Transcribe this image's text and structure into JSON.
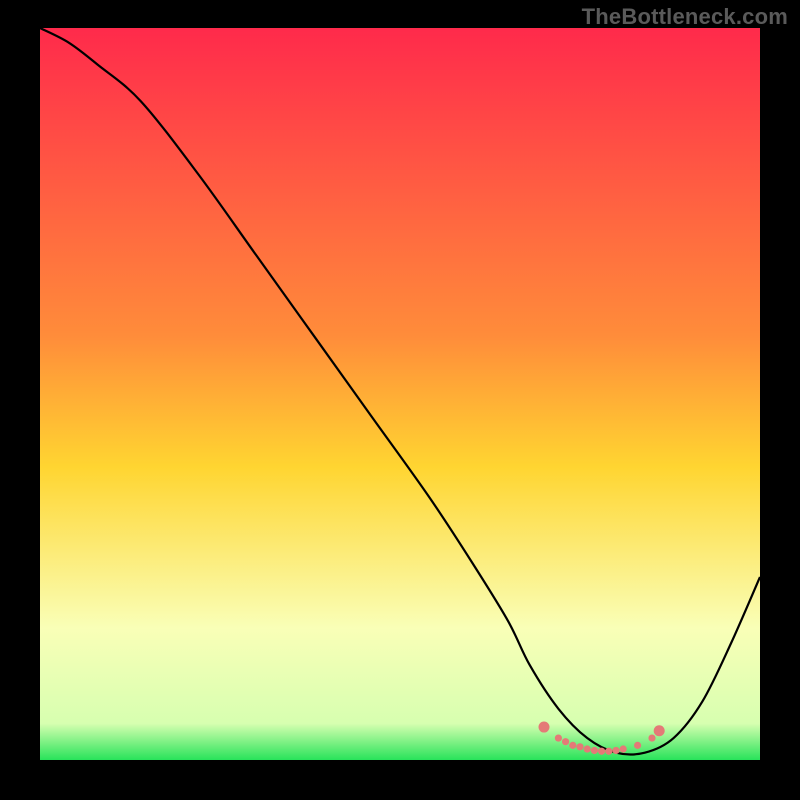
{
  "watermark": "TheBottleneck.com",
  "colors": {
    "bg_page": "#000000",
    "grad_top": "#ff2a4b",
    "grad_mid": "#ffd531",
    "grad_low": "#f9ffb7",
    "grad_bottom": "#28e35a",
    "curve": "#000000",
    "markers": "#e47a77",
    "watermark": "#5a5a5a"
  },
  "gradient_stops": [
    {
      "offset": 0.0,
      "color": "#ff2a4b"
    },
    {
      "offset": 0.42,
      "color": "#ff8c3a"
    },
    {
      "offset": 0.6,
      "color": "#ffd531"
    },
    {
      "offset": 0.82,
      "color": "#f9ffb7"
    },
    {
      "offset": 0.95,
      "color": "#d7ffb0"
    },
    {
      "offset": 1.0,
      "color": "#28e35a"
    }
  ],
  "chart_data": {
    "type": "line",
    "title": "",
    "xlabel": "",
    "ylabel": "",
    "xlim": [
      0,
      100
    ],
    "ylim": [
      0,
      100
    ],
    "series": [
      {
        "name": "bottleneck-curve",
        "x": [
          0,
          4,
          8,
          14,
          22,
          30,
          38,
          46,
          54,
          60,
          65,
          68,
          72,
          76,
          80,
          84,
          88,
          92,
          96,
          100
        ],
        "y": [
          100,
          98,
          95,
          90,
          80,
          69,
          58,
          47,
          36,
          27,
          19,
          13,
          7,
          3,
          1,
          1,
          3,
          8,
          16,
          25
        ]
      }
    ],
    "marker_cluster": {
      "name": "optimal-range-markers",
      "x": [
        70,
        72,
        73,
        74,
        75,
        76,
        77,
        78,
        79,
        80,
        81,
        83,
        85,
        86
      ],
      "y": [
        4.5,
        3.0,
        2.5,
        2.0,
        1.8,
        1.5,
        1.3,
        1.2,
        1.2,
        1.3,
        1.5,
        2.0,
        3.0,
        4.0
      ]
    }
  }
}
